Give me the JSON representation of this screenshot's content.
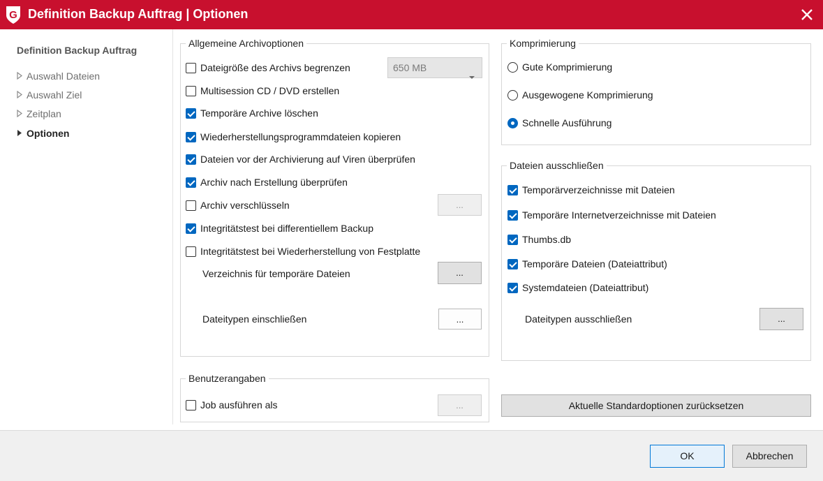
{
  "window": {
    "title": "Definition Backup Auftrag | Optionen",
    "accent_color": "#c8102e",
    "close_icon": "close-icon"
  },
  "sidebar": {
    "title": "Definition Backup Auftrag",
    "items": [
      {
        "label": "Auswahl Dateien",
        "active": false
      },
      {
        "label": "Auswahl Ziel",
        "active": false
      },
      {
        "label": "Zeitplan",
        "active": false
      },
      {
        "label": "Optionen",
        "active": true
      }
    ]
  },
  "archive_options": {
    "title": "Allgemeine Archivoptionen",
    "items": [
      {
        "label": "Dateigröße des Archivs begrenzen",
        "checked": false
      },
      {
        "label": "Multisession CD / DVD erstellen",
        "checked": false
      },
      {
        "label": "Temporäre Archive löschen",
        "checked": true
      },
      {
        "label": "Wiederherstellungsprogrammdateien kopieren",
        "checked": true
      },
      {
        "label": "Dateien vor der Archivierung auf Viren überprüfen",
        "checked": true
      },
      {
        "label": "Archiv nach Erstellung überprüfen",
        "checked": true
      },
      {
        "label": "Archiv verschlüsseln",
        "checked": false
      },
      {
        "label": "Integritätstest bei differentiellem Backup",
        "checked": true
      },
      {
        "label": "Integritätstest bei Wiederherstellung von Festplatte",
        "checked": false
      }
    ],
    "size_select": {
      "value": "650 MB"
    },
    "encrypt_button": "...",
    "temp_dir_label": "Verzeichnis für temporäre Dateien",
    "temp_dir_button": "...",
    "include_types_label": "Dateitypen einschließen",
    "include_types_button": "..."
  },
  "compression": {
    "title": "Komprimierung",
    "options": [
      {
        "label": "Gute Komprimierung",
        "selected": false
      },
      {
        "label": "Ausgewogene Komprimierung",
        "selected": false
      },
      {
        "label": "Schnelle Ausführung",
        "selected": true
      }
    ]
  },
  "exclude_files": {
    "title": "Dateien ausschließen",
    "items": [
      {
        "label": "Temporärverzeichnisse mit Dateien",
        "checked": true
      },
      {
        "label": "Temporäre Internetverzeichnisse mit Dateien",
        "checked": true
      },
      {
        "label": "Thumbs.db",
        "checked": true
      },
      {
        "label": "Temporäre Dateien (Dateiattribut)",
        "checked": true
      },
      {
        "label": "Systemdateien (Dateiattribut)",
        "checked": true
      }
    ],
    "exclude_types_label": "Dateitypen ausschließen",
    "exclude_types_button": "..."
  },
  "user_info": {
    "title": "Benutzerangaben",
    "run_as": {
      "label": "Job ausführen als",
      "checked": false
    },
    "run_as_button": "..."
  },
  "reset_button": "Aktuelle Standardoptionen zurücksetzen",
  "footer": {
    "ok": "OK",
    "cancel": "Abbrechen"
  }
}
